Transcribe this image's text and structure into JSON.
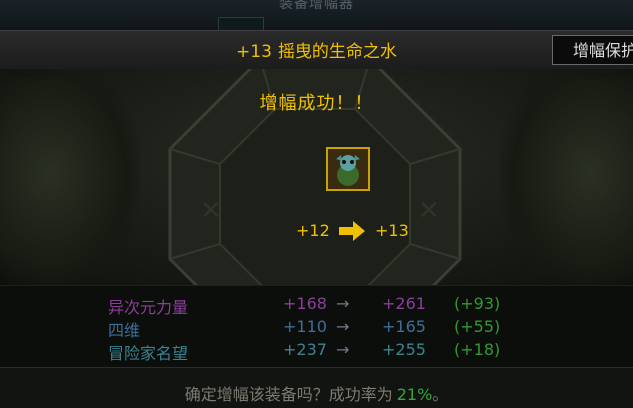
{
  "window": {
    "title": "装备增幅器"
  },
  "header": {
    "item_level": "+13",
    "item_name": "摇曳的生命之水",
    "tab_label": "增幅保护"
  },
  "result": {
    "message": "增幅成功！！",
    "from_level": "+12",
    "to_level": "+13"
  },
  "stats": [
    {
      "name": "异次元力量",
      "old": "+168",
      "arrow": "→",
      "new": "+261",
      "diff": "(+93)"
    },
    {
      "name": "四维",
      "old": "+110",
      "arrow": "→",
      "new": "+165",
      "diff": "(+55)"
    },
    {
      "name": "冒险家名望",
      "old": "+237",
      "arrow": "→",
      "new": "+255",
      "diff": "(+18)"
    }
  ],
  "footer": {
    "confirm_text": "确定增幅该装备吗？成功率为",
    "rate": "21%",
    "end": "。"
  },
  "colors": {
    "gold": "#f0c000",
    "stat_purple": "#8a3f9a",
    "stat_blue": "#3d6f9b",
    "stat_teal": "#3b8392",
    "diff_green": "#2f9a2f"
  }
}
